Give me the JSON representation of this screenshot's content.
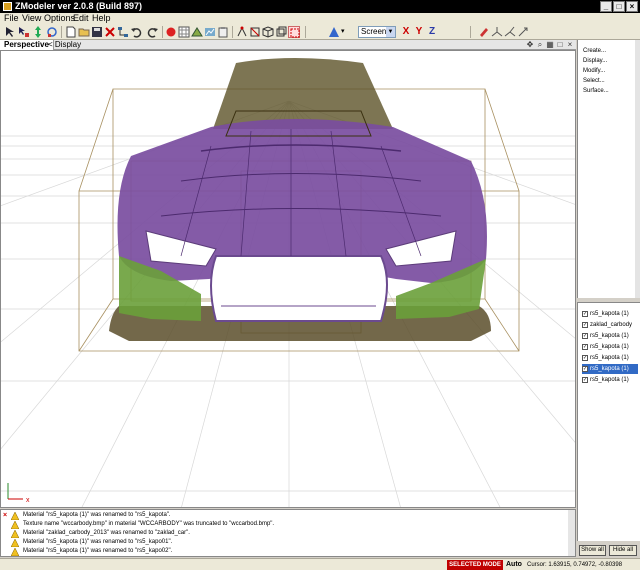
{
  "window": {
    "title": "ZModeler ver 2.0.8 (Build 897)"
  },
  "menu": [
    "File",
    "View",
    "Options",
    "Edit",
    "Help"
  ],
  "toolbar": {
    "coord_system": "Screen",
    "axes": [
      "X",
      "Y",
      "Z"
    ]
  },
  "viewport": {
    "tab": "Perspective",
    "display_label": "< Display"
  },
  "command_panel": {
    "items": [
      "Create...",
      "Display...",
      "Modify...",
      "Select...",
      "Surface..."
    ]
  },
  "objects": {
    "items": [
      {
        "name": "rs5_kapota (1)",
        "checked": true,
        "selected": false
      },
      {
        "name": "zaklad_carbody",
        "checked": true,
        "selected": false
      },
      {
        "name": "rs5_kapota (1)",
        "checked": true,
        "selected": false
      },
      {
        "name": "rs5_kapota (1)",
        "checked": true,
        "selected": false
      },
      {
        "name": "rs5_kapota (1)",
        "checked": true,
        "selected": false
      },
      {
        "name": "rs5_kapota (1)",
        "checked": true,
        "selected": true
      },
      {
        "name": "rs5_kapota (1)",
        "checked": true,
        "selected": false
      }
    ],
    "show_all": "Show all",
    "hide_all": "Hide all"
  },
  "log": [
    "Material \"rs5_kapota (1)\" was renamed to \"rs5_kapota\".",
    "Texture name \"wccarbody.bmp\" in material \"WCCARBODY\" was truncated to \"wccarbod.bmp\".",
    "Material \"zaklad_carbody_2013\" was renamed to \"zaklad_car\".",
    "Material \"rs5_kapota (1)\" was renamed to \"rs5_kapo01\".",
    "Material \"rs5_kapota (1)\" was renamed to \"rs5_kapo02\"."
  ],
  "status": {
    "mode": "SELECTED MODE",
    "auto": "Auto",
    "cursor": "Cursor: 1.63915, 0.74972, -0.80398"
  }
}
